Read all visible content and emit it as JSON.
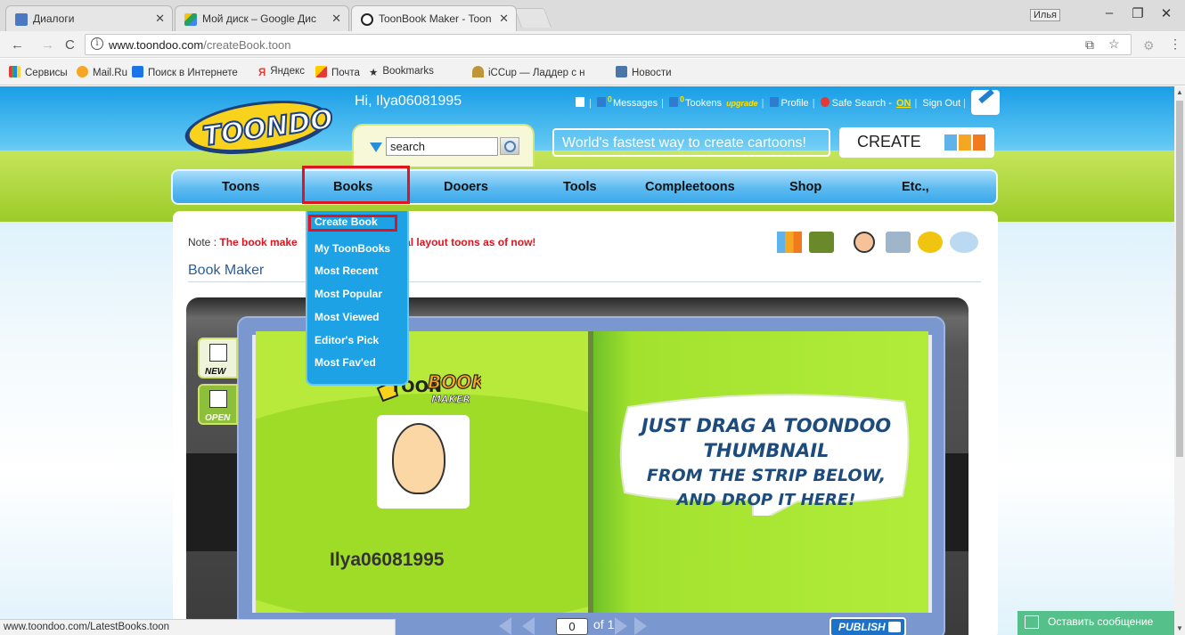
{
  "browser": {
    "tabs": [
      {
        "title": "Диалоги"
      },
      {
        "title": "Мой диск – Google Дис"
      },
      {
        "title": "ToonBook Maker - Toon"
      }
    ],
    "profile_name": "Илья",
    "url_host": "www.toondoo.com",
    "url_path": "/createBook.toon",
    "bookmarks": [
      "Сервисы",
      "Mail.Ru",
      "Поиск в Интернете",
      "Яндекс",
      "Почта",
      "Bookmarks",
      "iCCup — Ладдер с н",
      "Новости"
    ],
    "status_url": "www.toondoo.com/LatestBooks.toon"
  },
  "header": {
    "greeting": "Hi, Ilya06081995",
    "search_value": "search",
    "messages_label": "Messages",
    "messages_count": "0",
    "tookens_label": "Tookens",
    "tookens_count": "0",
    "upgrade_label": "upgrade",
    "profile_label": "Profile",
    "safe_search_label": "Safe Search -",
    "safe_search_state": "ON",
    "sign_out_label": "Sign Out",
    "slogan": "World's fastest way to create cartoons!",
    "create_label": "CREATE"
  },
  "nav": {
    "items": [
      "Toons",
      "Books",
      "Dooers",
      "Tools",
      "Compleetoons",
      "Shop",
      "Etc.,"
    ]
  },
  "books_menu": {
    "items": [
      "Create Book",
      "My ToonBooks",
      "Most Recent",
      "Most Popular",
      "Most Viewed",
      "Editor's Pick",
      "Most Fav'ed"
    ]
  },
  "content": {
    "note_prefix": "Note :",
    "note_text": "The book make",
    "note_text_end": "ertical layout toons as of now!",
    "title": "Book Maker",
    "side_new": "NEW",
    "side_open": "OPEN",
    "tb_logo_word": "BOOK",
    "tb_logo_sub": "MAKER",
    "tb_logo_prefix": "TOON",
    "username": "Ilya06081995",
    "bubble_line1": "JUST DRAG A TOONDOO THUMBNAIL",
    "bubble_line2": "FROM THE STRIP BELOW,",
    "bubble_line3": "AND DROP IT HERE!",
    "page_current": "0",
    "page_total_label": "of 1",
    "publish_label": "PUBLISH"
  },
  "chat_widget": {
    "label": "Оставить сообщение"
  },
  "colors": {
    "highlight": "#e0141e",
    "sky": "#1a9ee6",
    "grass": "#9ccb2a",
    "menu": "#1ea2e6"
  }
}
